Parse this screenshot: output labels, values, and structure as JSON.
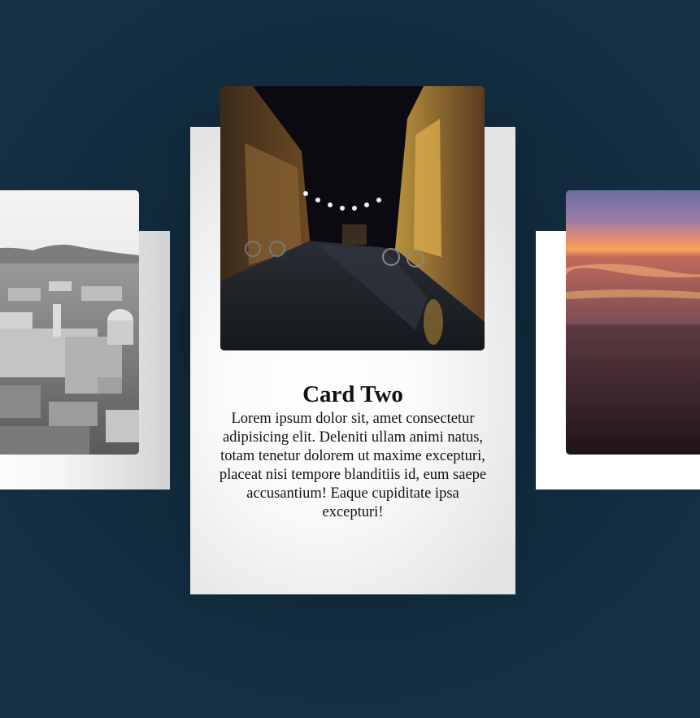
{
  "cards": [
    {
      "id": "left",
      "image_alt": "Black and white aerial view of a city with domed cathedral and hills"
    },
    {
      "id": "center",
      "title": "Card Two",
      "body": "Lorem ipsum dolor sit, amet consectetur adipisicing elit. Deleniti ullam animi natus, totam tenetur dolorem ut maxime excepturi, placeat nisi tempore blanditiis id, eum saepe accusantium! Eaque cupiditate ipsa excepturi!",
      "image_alt": "Night street with string lights, bicycles and wet pavement"
    },
    {
      "id": "right",
      "image_alt": "Sunset over the sea with orange and purple sky"
    }
  ]
}
